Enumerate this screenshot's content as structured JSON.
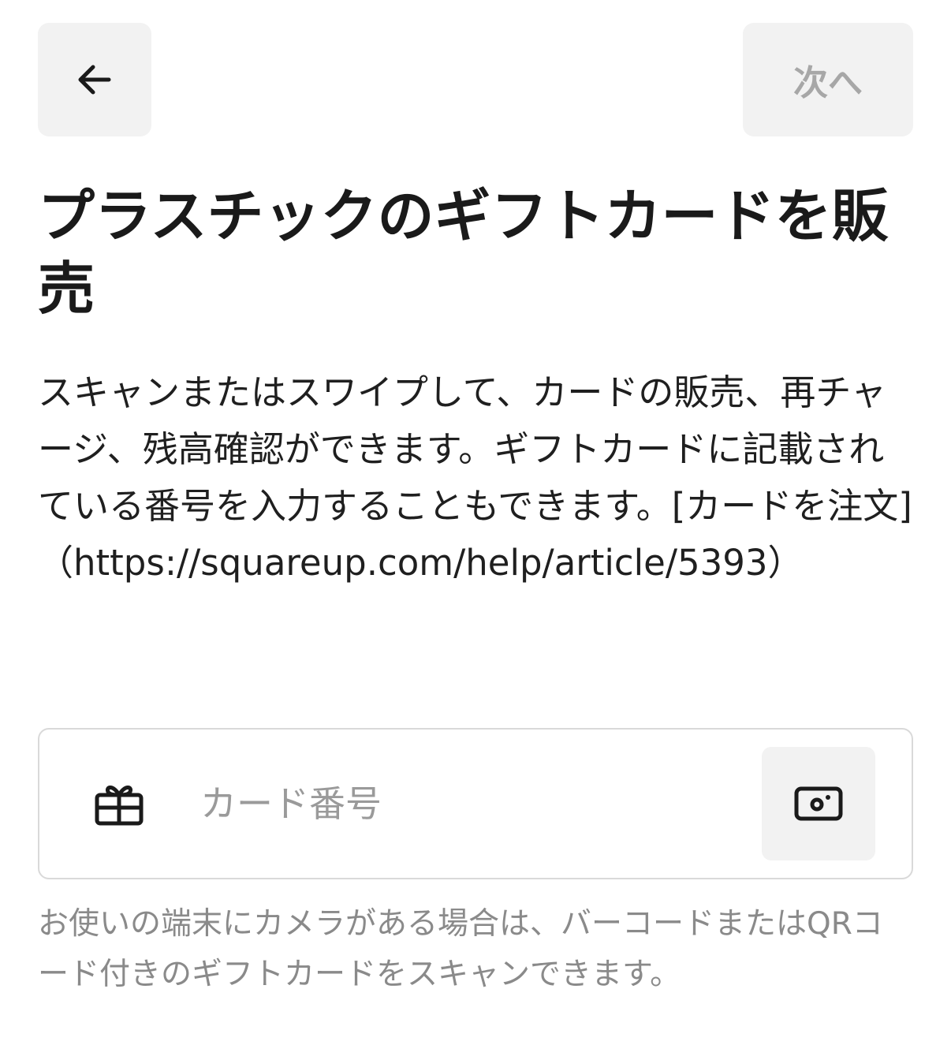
{
  "header": {
    "back_icon": "arrow-left-icon",
    "next_label": "次へ"
  },
  "title": "プラスチックのギフトカードを販売",
  "description": "スキャンまたはスワイプして、カードの販売、再チャージ、残高確認ができます。ギフトカードに記載されている番号を入力することもできます。[カードを注文]（https://squareup.com/help/article/5393）",
  "card_field": {
    "icon": "gift-icon",
    "placeholder": "カード番号",
    "value": "",
    "scan_icon": "camera-icon"
  },
  "helper_text": "お使いの端末にカメラがある場合は、バーコードまたはQRコード付きのギフトカードをスキャンできます。",
  "colors": {
    "button_bg": "#f2f2f2",
    "disabled_text": "#a7a7a7",
    "field_border": "#d9d9d9",
    "helper_text": "#8a8a8a",
    "text": "#1a1a1a"
  }
}
